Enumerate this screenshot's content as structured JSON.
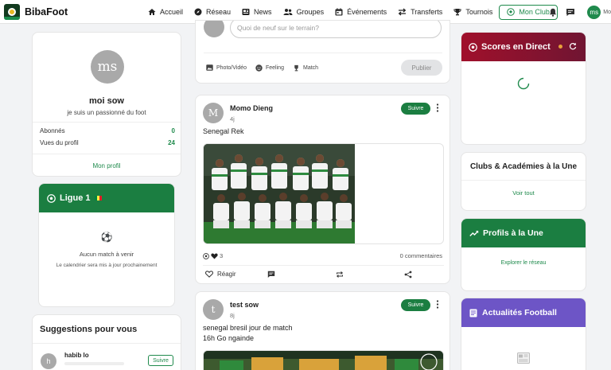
{
  "app": {
    "name": "BibaFoot"
  },
  "nav": {
    "items": [
      {
        "label": "Accueil",
        "icon": "home-icon"
      },
      {
        "label": "Réseau",
        "icon": "compass-icon"
      },
      {
        "label": "News",
        "icon": "newspaper-icon"
      },
      {
        "label": "Groupes",
        "icon": "users-icon"
      },
      {
        "label": "Événements",
        "icon": "calendar-icon"
      },
      {
        "label": "Transferts",
        "icon": "transfer-icon"
      },
      {
        "label": "Tournois",
        "icon": "trophy-icon"
      }
    ],
    "club_button": "Mon Club",
    "avatar_initials": "ms",
    "user_short": "Mo"
  },
  "profile": {
    "initials": "ms",
    "name": "moi sow",
    "bio": "je suis un passionné du foot",
    "stats": [
      {
        "label": "Abonnés",
        "value": "0"
      },
      {
        "label": "Vues du profil",
        "value": "24"
      }
    ],
    "link": "Mon profil"
  },
  "ligue": {
    "title": "Ligue 1",
    "flag_colors": [
      "#00853f",
      "#fdef42",
      "#e31b23"
    ],
    "empty_title": "Aucun match à venir",
    "empty_sub": "Le calendrier sera mis à jour prochainement"
  },
  "suggestions": {
    "title": "Suggestions pour vous",
    "items": [
      {
        "initial": "h",
        "name": "habib lo",
        "button": "Suivre"
      }
    ]
  },
  "composer": {
    "placeholder": "Quoi de neuf sur le terrain?",
    "actions": [
      "Photo/Vidéo",
      "Feeling",
      "Match"
    ],
    "publish": "Publier"
  },
  "posts": [
    {
      "initial": "M",
      "author": "Momo Dieng",
      "time": "4j",
      "follow": "Suivre",
      "text": [
        "Senegal Rek"
      ],
      "reaction_count": "3",
      "comments": "0 commentaires",
      "actions": {
        "like": "Réagir"
      }
    },
    {
      "initial": "t",
      "author": "test sow",
      "time": "8j",
      "follow": "Suivre",
      "text": [
        "senegal bresil jour de match",
        "16h Go ngainde"
      ]
    }
  ],
  "scores": {
    "title": "Scores en Direct"
  },
  "clubs": {
    "title": "Clubs & Académies à la Une",
    "link": "Voir tout"
  },
  "profils": {
    "title": "Profils à la Une",
    "link": "Explorer le réseau"
  },
  "actus": {
    "title": "Actualités Football"
  },
  "colors": {
    "brand_green": "#1b7e41",
    "scores_red": "#a0102b",
    "news_purple": "#6d55c6"
  }
}
